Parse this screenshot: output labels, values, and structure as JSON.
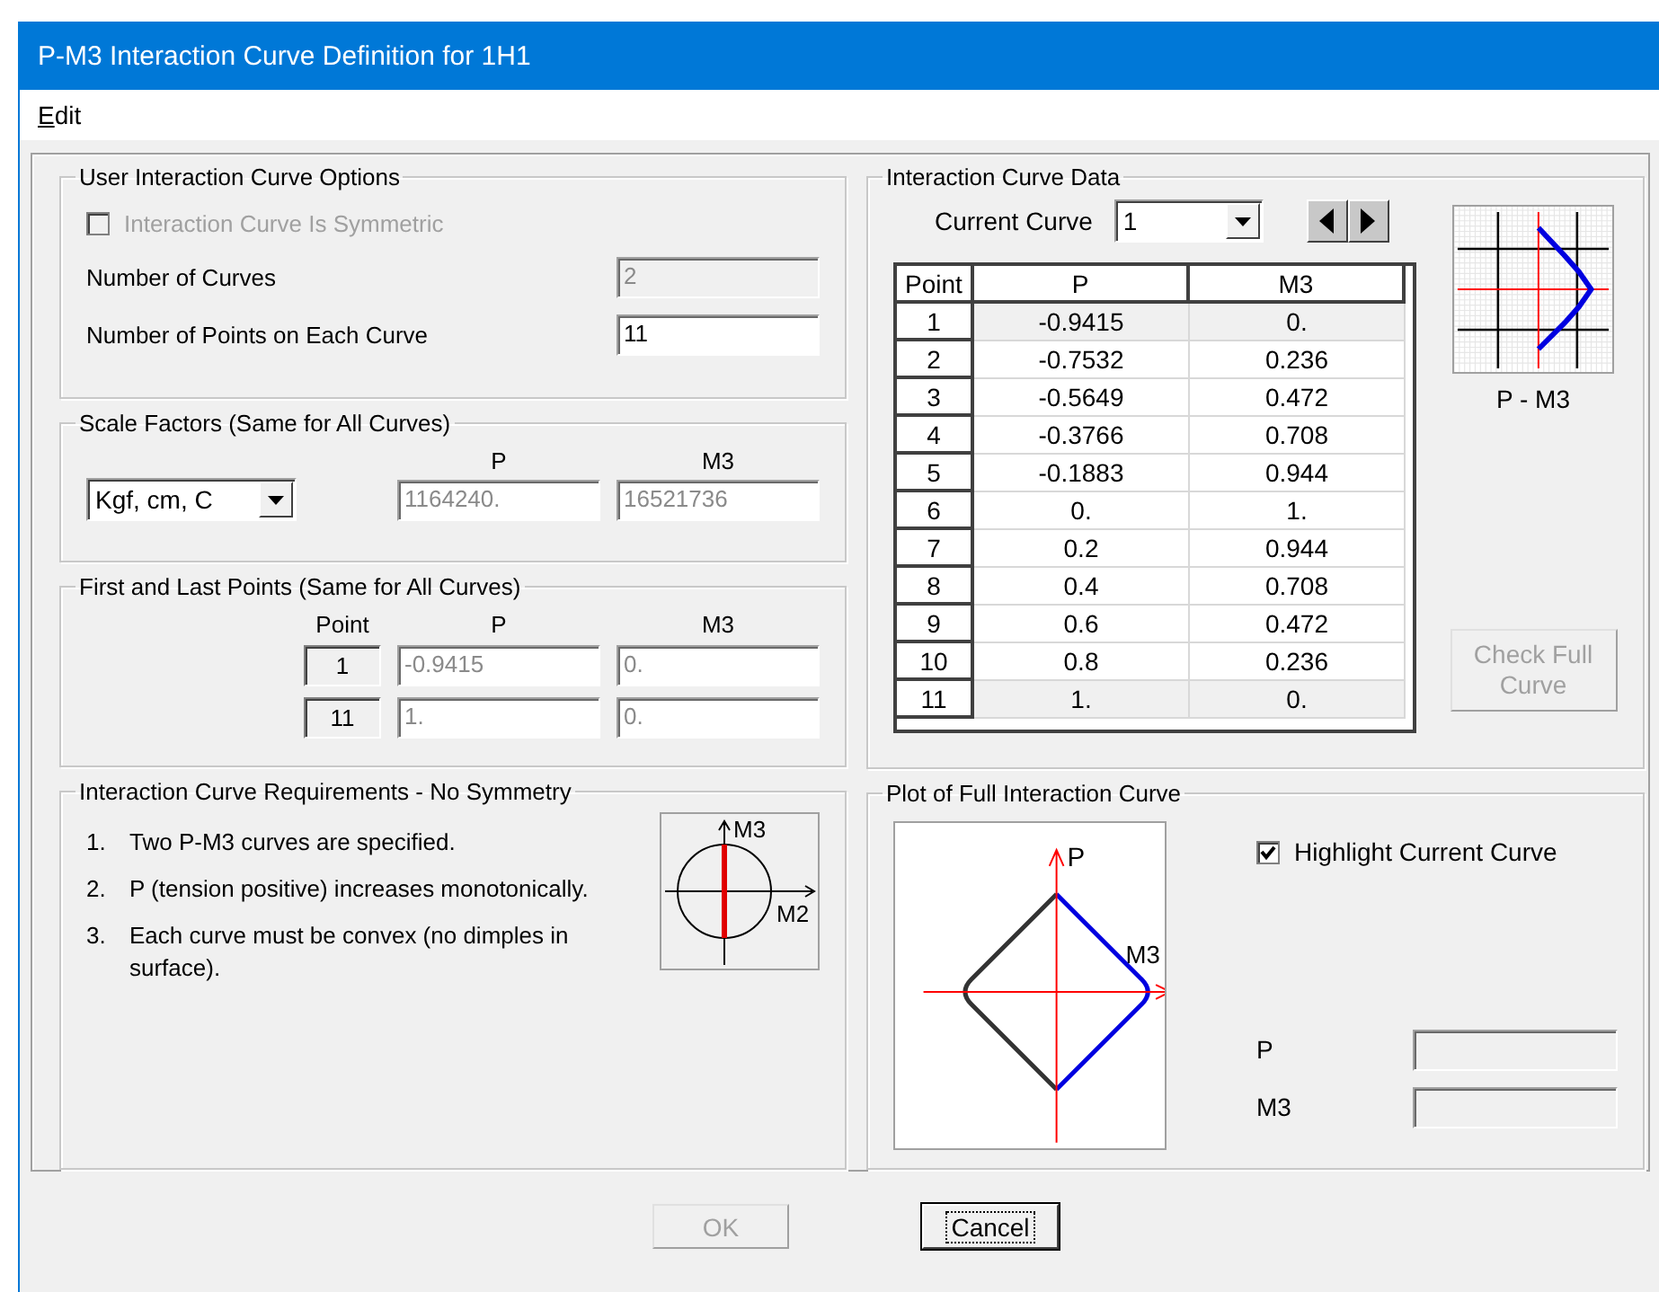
{
  "window": {
    "title": "P-M3 Interaction Curve Definition for 1H1"
  },
  "menu": [
    {
      "label": "Edit"
    }
  ],
  "user_options": {
    "title": "User Interaction Curve Options",
    "symmetric": {
      "label": "Interaction Curve Is Symmetric",
      "checked": false,
      "disabled": true
    },
    "fields": [
      {
        "label": "Number of Curves",
        "value": "2",
        "disabled": true
      },
      {
        "label": "Number of Points on Each Curve",
        "value": "11",
        "disabled": false
      }
    ]
  },
  "scale_factors": {
    "title": "Scale Factors (Same for All Curves)",
    "units": "Kgf, cm, C",
    "columns": [
      "P",
      "M3"
    ],
    "values": [
      "1164240.",
      "16521736"
    ]
  },
  "end_points": {
    "title": "First and Last Points (Same for All Curves)",
    "columns": [
      "Point",
      "P",
      "M3"
    ],
    "rows": [
      {
        "point": "1",
        "p": "-0.9415",
        "m3": "0."
      },
      {
        "point": "11",
        "p": "1.",
        "m3": "0."
      }
    ]
  },
  "requirements": {
    "title": "Interaction Curve Requirements - No Symmetry",
    "items": [
      {
        "number": "1.",
        "text": "Two P-M3 curves are specified."
      },
      {
        "number": "2.",
        "text": "P (tension positive) increases monotonically."
      },
      {
        "number": "3.",
        "text": "Each curve must be convex (no dimples in surface)."
      }
    ],
    "diagram_labels": [
      "M3",
      "M2"
    ]
  },
  "curve_data": {
    "title": "Interaction Curve Data",
    "current_curve_label": "Current Curve",
    "current_curve": "1",
    "columns": [
      "Point",
      "P",
      "M3"
    ],
    "rows": [
      {
        "point": "1",
        "p": "-0.9415",
        "m3": "0.",
        "fixed": true
      },
      {
        "point": "2",
        "p": "-0.7532",
        "m3": "0.236",
        "fixed": false
      },
      {
        "point": "3",
        "p": "-0.5649",
        "m3": "0.472",
        "fixed": false
      },
      {
        "point": "4",
        "p": "-0.3766",
        "m3": "0.708",
        "fixed": false
      },
      {
        "point": "5",
        "p": "-0.1883",
        "m3": "0.944",
        "fixed": false
      },
      {
        "point": "6",
        "p": "0.",
        "m3": "1.",
        "fixed": false
      },
      {
        "point": "7",
        "p": "0.2",
        "m3": "0.944",
        "fixed": false
      },
      {
        "point": "8",
        "p": "0.4",
        "m3": "0.708",
        "fixed": false
      },
      {
        "point": "9",
        "p": "0.6",
        "m3": "0.472",
        "fixed": false
      },
      {
        "point": "10",
        "p": "0.8",
        "m3": "0.236",
        "fixed": false
      },
      {
        "point": "11",
        "p": "1.",
        "m3": "0.",
        "fixed": true
      }
    ],
    "preview_caption": "P - M3",
    "check_button": {
      "label": "Check Full Curve",
      "disabled": true
    }
  },
  "plot": {
    "title": "Plot of Full Interaction Curve",
    "axis_labels": [
      "P",
      "M3"
    ],
    "highlight": {
      "label": "Highlight Current Curve",
      "checked": true
    },
    "readouts": [
      {
        "label": "P"
      },
      {
        "label": "M3"
      }
    ]
  },
  "buttons": [
    {
      "label": "OK",
      "disabled": true,
      "focused": false
    },
    {
      "label": "Cancel",
      "disabled": false,
      "focused": true
    }
  ]
}
